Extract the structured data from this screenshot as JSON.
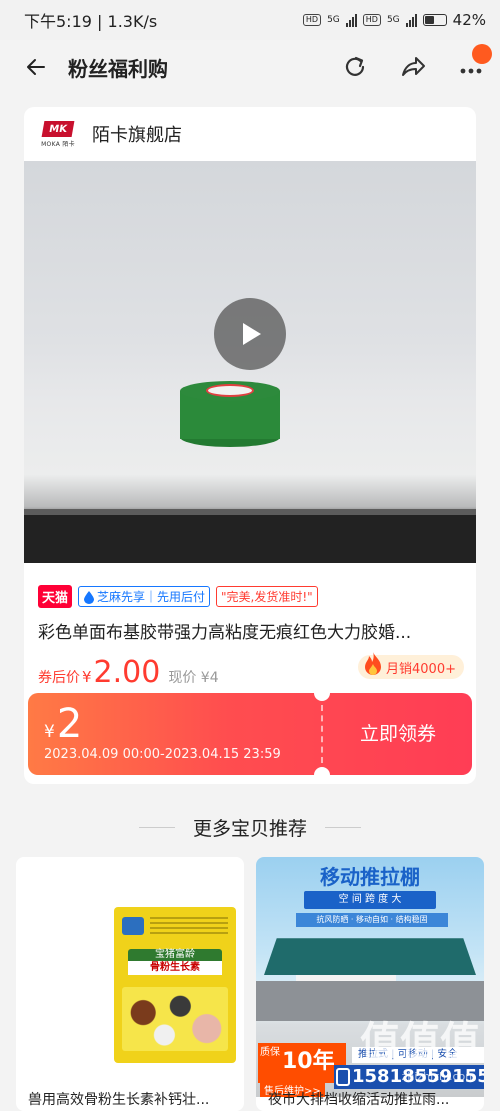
{
  "status_bar": {
    "time": "下午5:19",
    "speed": "1.3K/s",
    "hd1": "HD",
    "net1": "5G",
    "hd2": "HD",
    "net2": "5G",
    "battery": "42%"
  },
  "nav": {
    "title": "粉丝福利购"
  },
  "shop": {
    "logo_mark": "MK",
    "logo_sub": "MOKA 陌卡",
    "name": "陌卡旗舰店"
  },
  "product": {
    "badge_tmall": "天猫",
    "badge_zhima": "芝麻先享｜先用后付",
    "badge_slogan": "\"完美,发货准时!\"",
    "title": "彩色单面布基胶带强力高粘度无痕红色大力胶婚...",
    "price_label": "券后价",
    "price_yen": "¥",
    "price_value": "2.00",
    "original_price": "现价 ¥4",
    "monthly_sales": "月销4000+"
  },
  "coupon": {
    "yen": "¥",
    "amount": "2",
    "period": "2023.04.09 00:00-2023.04.15 23:59",
    "claim_label": "立即领券"
  },
  "more": {
    "heading": "更多宝贝推荐"
  },
  "recommendations": [
    {
      "title": "兽用高效骨粉生长素补钙壮...",
      "image_band": "宝猪富龄",
      "image_product": "骨粉生长素"
    },
    {
      "title": "夜市大排档收缩活动推拉雨...",
      "image_heading": "移动推拉棚",
      "image_sub": "空 间 跨 度 大",
      "image_features": "抗风防晒 · 移动自如 · 结构稳固",
      "warranty_years": "10年",
      "warranty_label": "质保",
      "warranty_service": "售后维护>>",
      "mid_strip": "推拉式 | 可移动 | 安全",
      "phone": "15818559155",
      "watermark": "值值值",
      "watermark_sub": "zhizhizhi.com"
    }
  ]
}
